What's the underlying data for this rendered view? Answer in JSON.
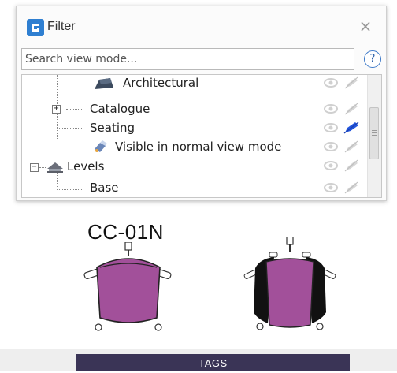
{
  "filter_panel": {
    "title": "Filter",
    "close_symbol": "×",
    "search": {
      "placeholder": "Search view mode...",
      "value": ""
    },
    "help_symbol": "?",
    "tree": [
      {
        "label": "Architectural",
        "icon": "wall-icon",
        "visible": true,
        "editable": false
      },
      {
        "label": "Catalogue",
        "icon": "expand-plus-icon",
        "visible": true,
        "editable": false
      },
      {
        "label": "Seating",
        "icon": "",
        "visible": true,
        "editable": true
      },
      {
        "label": "Visible in normal view mode",
        "icon": "view-mode-icon",
        "visible": true,
        "editable": false
      },
      {
        "label": "Levels",
        "icon": "levels-icon",
        "visible": true,
        "editable": false
      },
      {
        "label": "Base",
        "icon": "",
        "visible": true,
        "editable": false
      }
    ],
    "colors": {
      "accent": "#2f7fd1",
      "edit_active": "#2255dd",
      "inactive_icon": "#cfcfcf"
    }
  },
  "drawing": {
    "symbol_label": "CC-01N",
    "chair_color": "#a2509a"
  },
  "footer": {
    "tags_label": "TAGS",
    "tags_color": "#3a3456"
  }
}
